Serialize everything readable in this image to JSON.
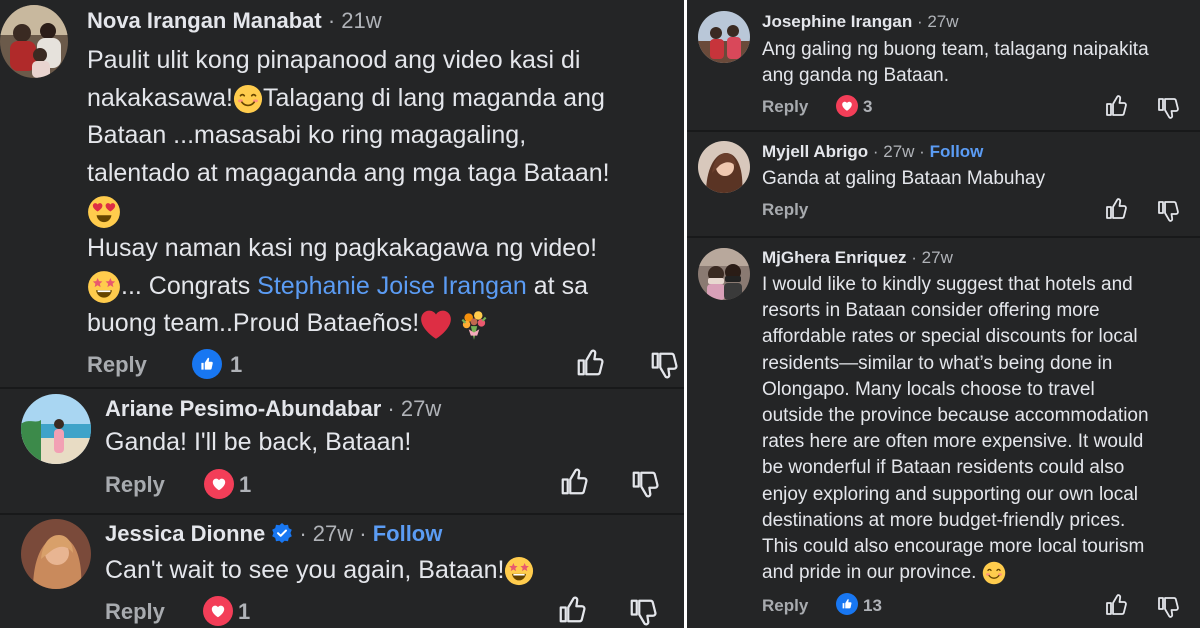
{
  "left": {
    "c1": {
      "author": "Nova Irangan Manabat",
      "time": "21w",
      "lines": [
        "Paulit ulit kong pinapanood ang video kasi di",
        "nakakasawa!",
        "Talagang di lang maganda ang",
        "Bataan ...masasabi ko ring magagaling,",
        "talentado at magaganda ang mga taga Bataan!",
        "Husay naman kasi ng  pagkakagawa ng video!",
        "... Congrats ",
        "Stephanie Joise Irangan",
        " at sa",
        "buong team..Proud Bataeños!"
      ],
      "reply": "Reply",
      "count": "1",
      "reaction": "like"
    },
    "c2": {
      "author": "Ariane Pesimo-Abundabar",
      "time": "27w",
      "text": "Ganda! I'll be back, Bataan!",
      "reply": "Reply",
      "count": "1",
      "reaction": "love"
    },
    "c3": {
      "author": "Jessica Dionne",
      "time": "27w",
      "follow": "Follow",
      "text": "Can't wait to see you again, Bataan!",
      "reply": "Reply",
      "count": "1",
      "reaction": "love"
    }
  },
  "right": {
    "c1": {
      "author": "Josephine Irangan",
      "time": "27w",
      "lines": [
        "Ang galing ng buong team, talagang naipakita",
        "ang ganda ng Bataan."
      ],
      "reply": "Reply",
      "count": "3",
      "reaction": "love"
    },
    "c2": {
      "author": "Myjell Abrigo",
      "time": "27w",
      "follow": "Follow",
      "text": "Ganda at galing Bataan Mabuhay",
      "reply": "Reply"
    },
    "c3": {
      "author": "MjGhera Enriquez",
      "time": "27w",
      "lines": [
        "I would like to kindly suggest that hotels and",
        "resorts in Bataan consider offering more",
        "affordable rates or special discounts for local",
        "residents—similar to what’s being done in",
        "Olongapo. Many locals choose to travel",
        "outside the province because accommodation",
        "rates here are often more expensive. It would",
        "be wonderful if Bataan residents could also",
        "enjoy exploring and supporting our own local",
        "destinations at more budget-friendly prices.",
        "This could also encourage more local tourism",
        "and pride in our province."
      ],
      "reply": "Reply",
      "count": "13",
      "reaction": "like"
    }
  },
  "separator": "·",
  "colors": {
    "bg": "#242526",
    "text": "#e4e6eb",
    "muted": "#b0b3b8",
    "link": "#5b9cf4",
    "like": "#1877f2",
    "love": "#f33e58"
  },
  "icons": [
    "thumbs-up-icon",
    "thumbs-down-icon",
    "like-reaction-icon",
    "love-reaction-icon",
    "verified-badge-icon",
    "smile-emoji-icon",
    "heart-eyes-emoji-icon",
    "star-struck-emoji-icon",
    "red-heart-emoji-icon",
    "bouquet-emoji-icon"
  ]
}
